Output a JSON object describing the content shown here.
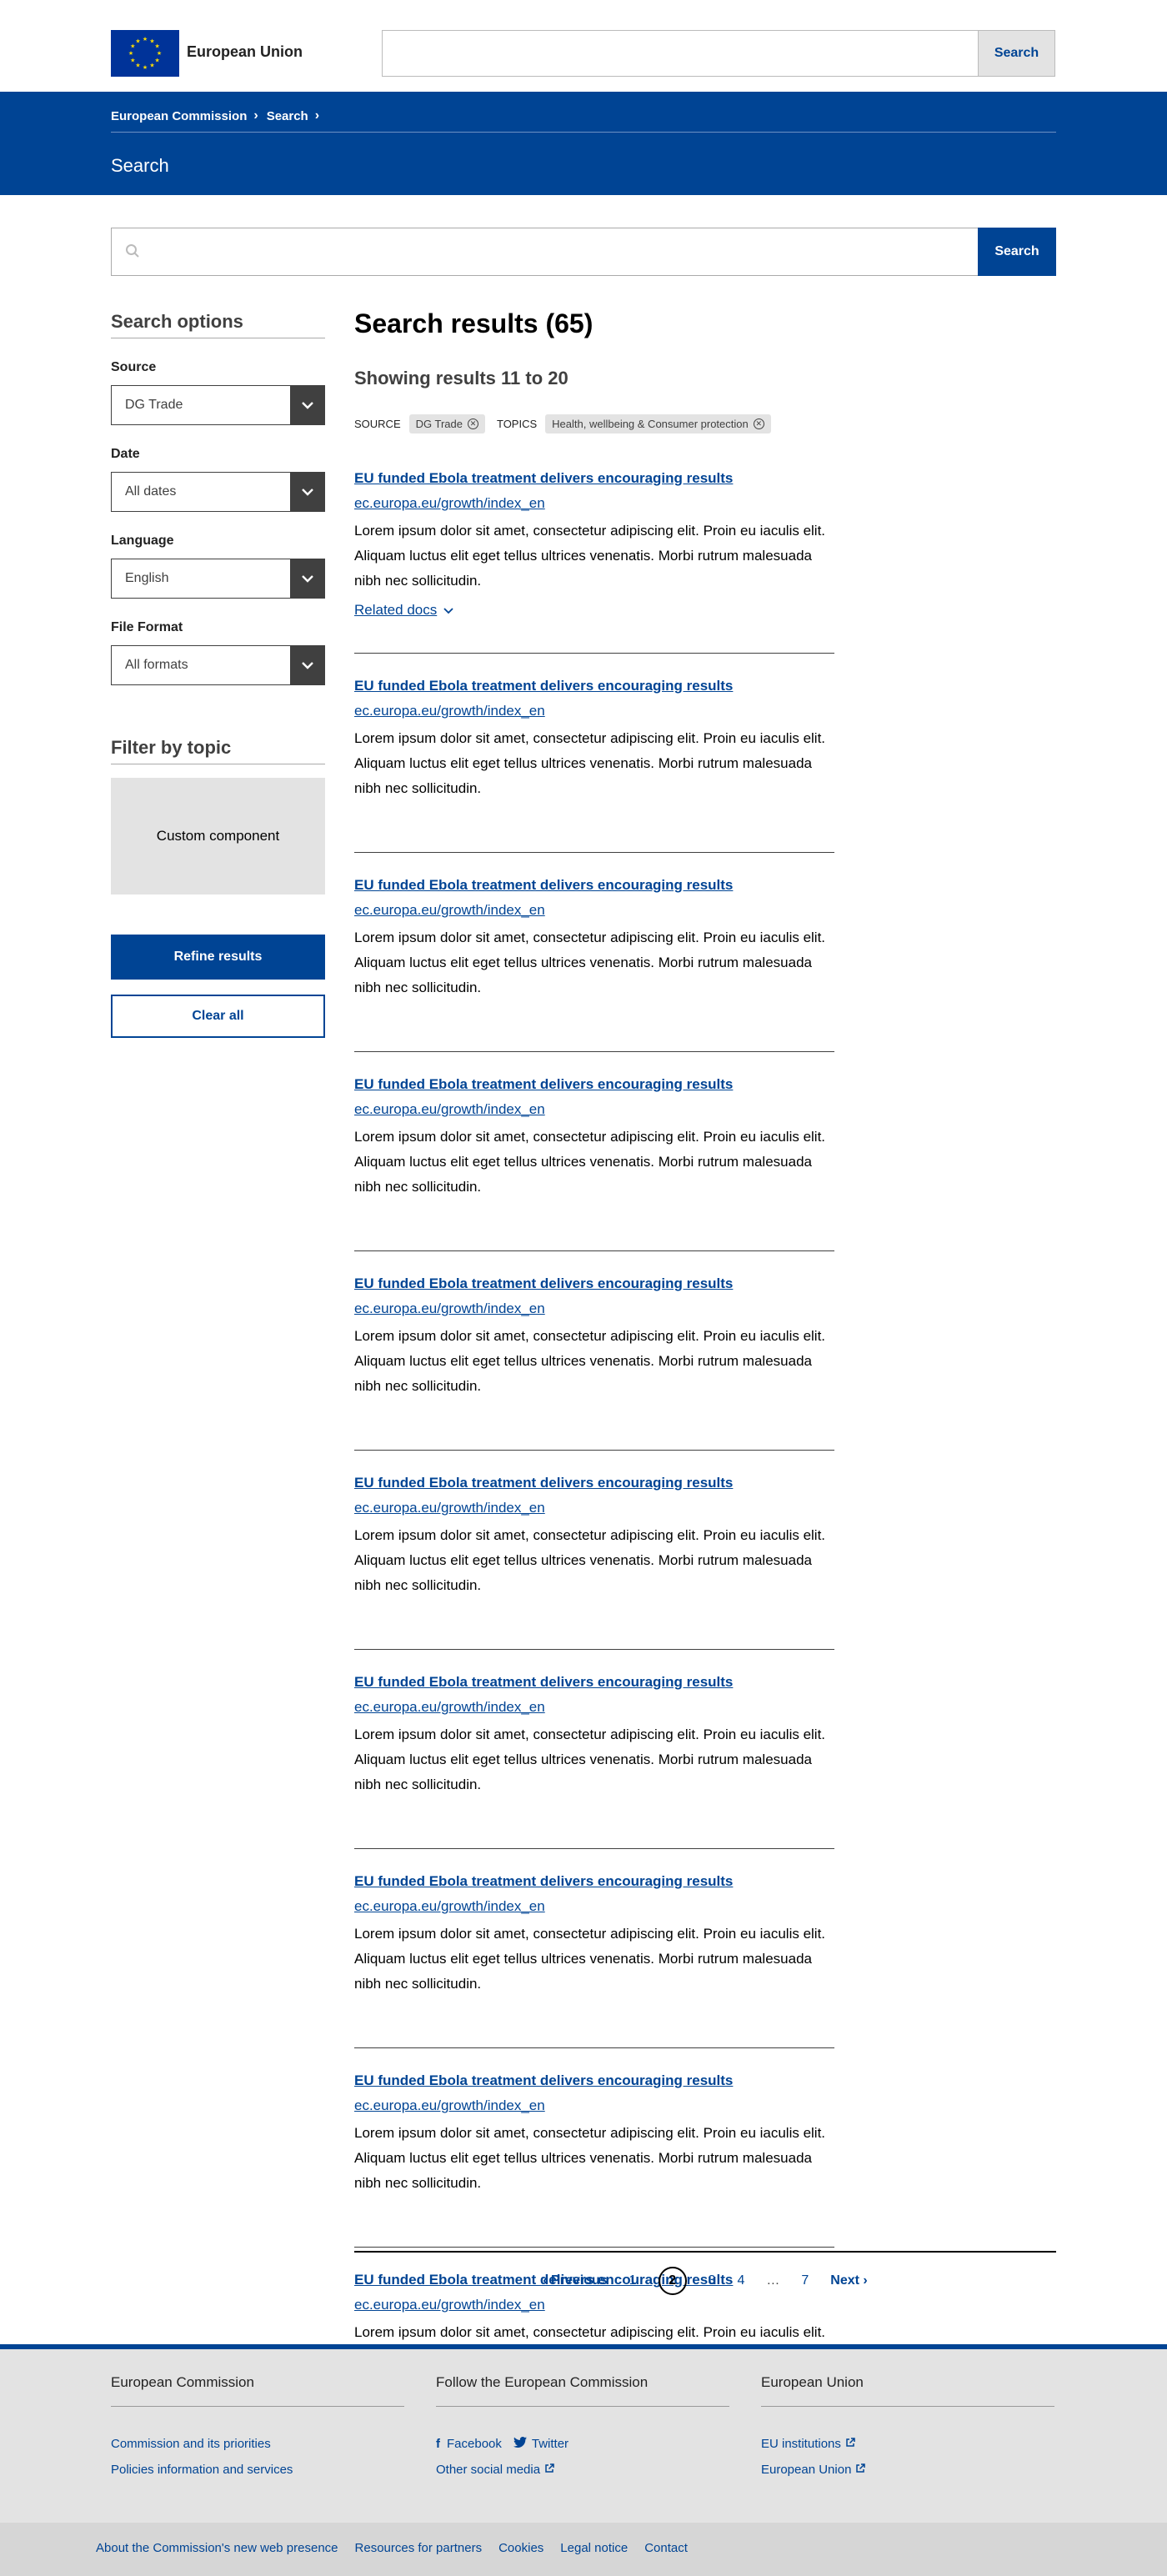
{
  "header": {
    "site_name": "European Union",
    "search_placeholder": "",
    "search_button": "Search"
  },
  "band": {
    "breadcrumb": [
      "European Commission",
      "Search"
    ],
    "page_title": "Search"
  },
  "main_search": {
    "placeholder": "",
    "button": "Search"
  },
  "sidebar": {
    "options_title": "Search options",
    "fields": [
      {
        "label": "Source",
        "value": "DG Trade"
      },
      {
        "label": "Date",
        "value": "All dates"
      },
      {
        "label": "Language",
        "value": "English"
      },
      {
        "label": "File Format",
        "value": "All formats"
      }
    ],
    "filter_title": "Filter by topic",
    "custom_component": "Custom component",
    "refine_button": "Refine results",
    "clear_button": "Clear all"
  },
  "results": {
    "title": "Search results (65)",
    "subtitle": "Showing results 11 to 20",
    "facets": [
      {
        "label": "SOURCE",
        "chip": "DG Trade"
      },
      {
        "label": "TOPICS",
        "chip": "Health, wellbeing & Consumer protection"
      }
    ],
    "related_docs": "Related docs",
    "items": [
      {
        "title": "EU funded Ebola treatment delivers encouraging results",
        "url": "ec.europa.eu/growth/index_en",
        "desc": "Lorem ipsum dolor sit amet, consectetur adipiscing elit. Proin eu iaculis elit. Aliquam luctus elit eget tellus ultrices venenatis. Morbi rutrum malesuada nibh nec sollicitudin."
      },
      {
        "title": "EU funded Ebola treatment delivers encouraging results",
        "url": "ec.europa.eu/growth/index_en",
        "desc": "Lorem ipsum dolor sit amet, consectetur adipiscing elit. Proin eu iaculis elit. Aliquam luctus elit eget tellus ultrices venenatis. Morbi rutrum malesuada nibh nec sollicitudin."
      },
      {
        "title": "EU funded Ebola treatment delivers encouraging results",
        "url": "ec.europa.eu/growth/index_en",
        "desc": "Lorem ipsum dolor sit amet, consectetur adipiscing elit. Proin eu iaculis elit. Aliquam luctus elit eget tellus ultrices venenatis. Morbi rutrum malesuada nibh nec sollicitudin."
      },
      {
        "title": "EU funded Ebola treatment delivers encouraging results",
        "url": "ec.europa.eu/growth/index_en",
        "desc": "Lorem ipsum dolor sit amet, consectetur adipiscing elit. Proin eu iaculis elit. Aliquam luctus elit eget tellus ultrices venenatis. Morbi rutrum malesuada nibh nec sollicitudin."
      },
      {
        "title": "EU funded Ebola treatment delivers encouraging results",
        "url": "ec.europa.eu/growth/index_en",
        "desc": "Lorem ipsum dolor sit amet, consectetur adipiscing elit. Proin eu iaculis elit. Aliquam luctus elit eget tellus ultrices venenatis. Morbi rutrum malesuada nibh nec sollicitudin."
      },
      {
        "title": "EU funded Ebola treatment delivers encouraging results",
        "url": "ec.europa.eu/growth/index_en",
        "desc": "Lorem ipsum dolor sit amet, consectetur adipiscing elit. Proin eu iaculis elit. Aliquam luctus elit eget tellus ultrices venenatis. Morbi rutrum malesuada nibh nec sollicitudin."
      },
      {
        "title": "EU funded Ebola treatment delivers encouraging results",
        "url": "ec.europa.eu/growth/index_en",
        "desc": "Lorem ipsum dolor sit amet, consectetur adipiscing elit. Proin eu iaculis elit. Aliquam luctus elit eget tellus ultrices venenatis. Morbi rutrum malesuada nibh nec sollicitudin."
      },
      {
        "title": "EU funded Ebola treatment delivers encouraging results",
        "url": "ec.europa.eu/growth/index_en",
        "desc": "Lorem ipsum dolor sit amet, consectetur adipiscing elit. Proin eu iaculis elit. Aliquam luctus elit eget tellus ultrices venenatis. Morbi rutrum malesuada nibh nec sollicitudin."
      },
      {
        "title": "EU funded Ebola treatment delivers encouraging results",
        "url": "ec.europa.eu/growth/index_en",
        "desc": "Lorem ipsum dolor sit amet, consectetur adipiscing elit. Proin eu iaculis elit. Aliquam luctus elit eget tellus ultrices venenatis. Morbi rutrum malesuada nibh nec sollicitudin."
      },
      {
        "title": "EU funded Ebola treatment delivers encouraging results",
        "url": "ec.europa.eu/growth/index_en",
        "desc": "Lorem ipsum dolor sit amet, consectetur adipiscing elit. Proin eu iaculis elit. Aliquam luctus elit eget tellus ultrices venenatis. Morbi rutrum malesuada nibh nec sollicitudin."
      }
    ]
  },
  "pagination": {
    "previous": "‹ Previous",
    "pages": [
      "1",
      "2",
      "3",
      "4",
      "…",
      "7"
    ],
    "current": "2",
    "next": "Next ›"
  },
  "footer": {
    "columns": [
      {
        "title": "European Commission",
        "links": [
          {
            "label": "Commission and its priorities",
            "icon": ""
          },
          {
            "label": "Policies information and services",
            "icon": ""
          }
        ]
      },
      {
        "title": "Follow the European Commission",
        "links": [
          {
            "label": "Facebook",
            "icon": "facebook-icon"
          },
          {
            "label": "Twitter",
            "icon": "twitter-icon"
          },
          {
            "label": "Other social media",
            "icon": "external-link-icon"
          }
        ]
      },
      {
        "title": "European Union",
        "links": [
          {
            "label": "EU institutions",
            "icon": "external-link-icon"
          },
          {
            "label": "European Union",
            "icon": "external-link-icon"
          }
        ]
      }
    ],
    "bottom_links": [
      "About the Commission's new web presence",
      "Resources for partners",
      "Cookies",
      "Legal notice",
      "Contact"
    ]
  },
  "colors": {
    "primary_blue": "#004494",
    "dark_grey": "#404040",
    "light_grey": "#e3e3e3",
    "eu_star_yellow": "#ffde00"
  }
}
